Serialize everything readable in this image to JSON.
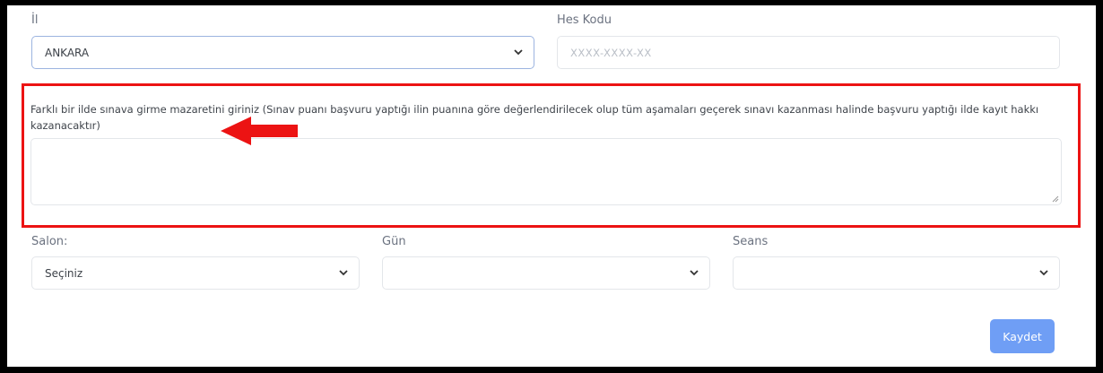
{
  "form": {
    "il_label": "İl",
    "il_value": "ANKARA",
    "hes_label": "Hes Kodu",
    "hes_placeholder": "XXXX-XXXX-XX",
    "excuse_label": "Farklı bir ilde sınava girme mazaretini giriniz (Sınav puanı başvuru yaptığı ilin puanına göre değerlendirilecek olup tüm aşamaları geçerek sınavı kazanması halinde başvuru yaptığı ilde kayıt hakkı kazanacaktır)",
    "excuse_value": "",
    "salon_label": "Salon:",
    "salon_value": "Seçiniz",
    "gun_label": "Gün",
    "gun_value": "",
    "seans_label": "Seans",
    "seans_value": "",
    "save_label": "Kaydet"
  },
  "colors": {
    "highlight_border": "#ec1313",
    "arrow": "#ec1313",
    "save_button": "#6f9ef5",
    "active_select_border": "#9cb4e0"
  },
  "icons": [
    "chevron-down-icon",
    "arrow-left-icon",
    "resize-handle-icon"
  ]
}
